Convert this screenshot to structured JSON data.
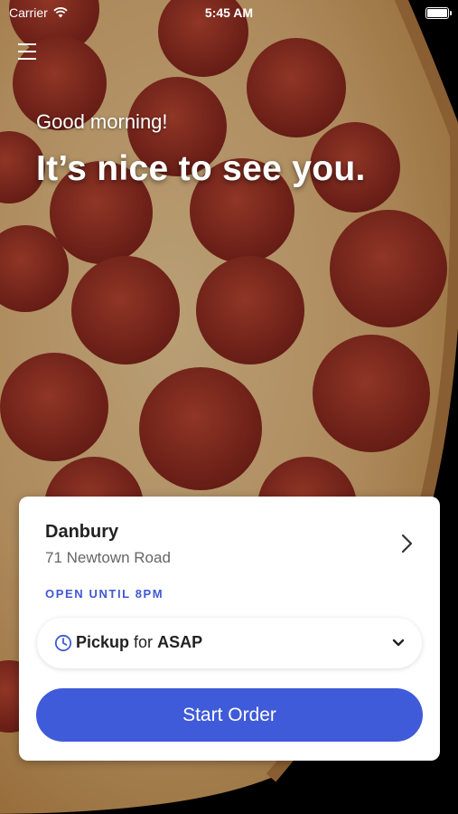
{
  "status_bar": {
    "carrier": "Carrier",
    "time": "5:45 AM"
  },
  "header": {
    "menu_icon": "hamburger-menu-icon"
  },
  "greeting": {
    "line1": "Good morning!",
    "line2": "It’s nice to see you."
  },
  "store": {
    "name": "Danbury",
    "address": "71 Newtown Road",
    "hours": "OPEN UNTIL 8PM"
  },
  "order": {
    "mode": "Pickup",
    "connector": "for",
    "time": "ASAP",
    "start_label": "Start Order"
  },
  "colors": {
    "accent": "#3f5bd9",
    "hours_text": "#3f57d6"
  }
}
